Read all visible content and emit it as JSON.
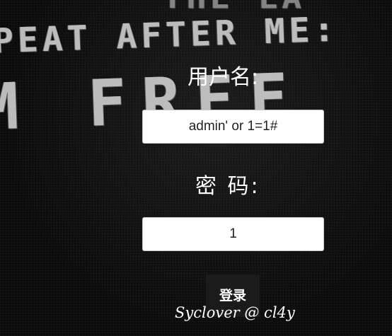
{
  "background": {
    "poster_lines": [
      "THE LA",
      "PEAT AFTER ME:",
      "M FREE"
    ]
  },
  "form": {
    "username_label": "用户名:",
    "username_value": "admin' or 1=1#",
    "password_label": "密 码:",
    "password_value": "1",
    "login_button": "登录"
  },
  "footer": {
    "credit": "Syclover @ cl4y"
  }
}
